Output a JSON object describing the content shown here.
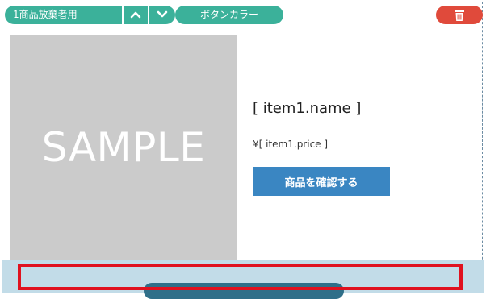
{
  "toolbar": {
    "label": "1商品放棄者用",
    "color_label": "ボタンカラー",
    "up_icon": "chevron-up-icon",
    "down_icon": "chevron-down-icon",
    "trash_icon": "trash-icon"
  },
  "product": {
    "image_text": "SAMPLE",
    "name": "[ item1.name ]",
    "price": "¥[ item1.price ]",
    "confirm_label": "商品を確認する"
  },
  "colors": {
    "toolbar_green": "#3bb19a",
    "trash_red": "#e04a3b",
    "confirm_blue": "#3a86c2",
    "sample_gray": "#cbcbcb",
    "highlight_red": "#e0121f"
  }
}
